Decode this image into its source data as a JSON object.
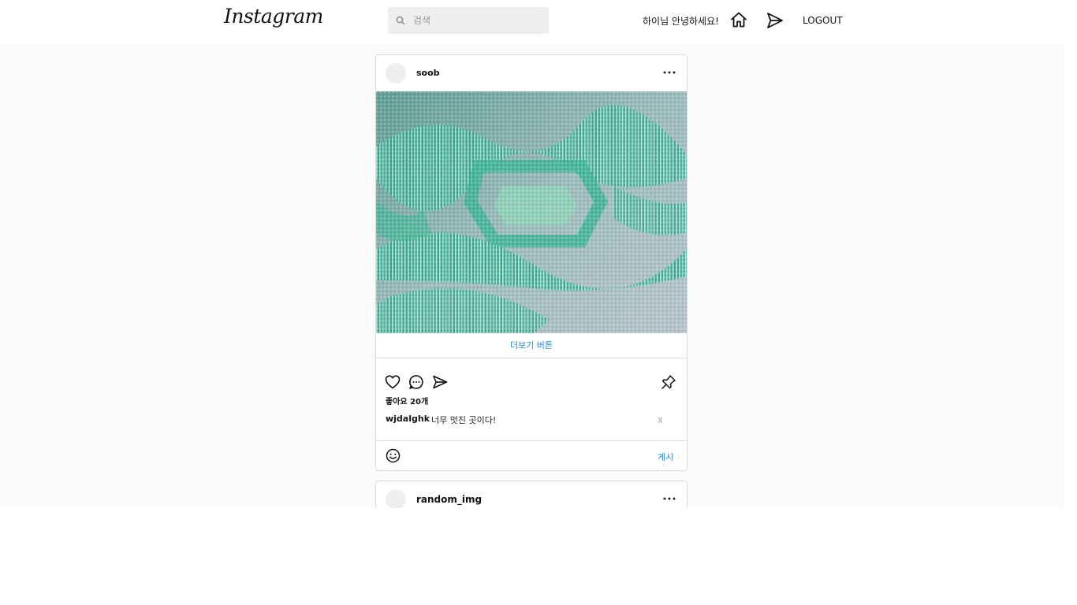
{
  "header": {
    "logo": "Instagram",
    "search_placeholder": "검색",
    "greeting": "하이님 안녕하세요!",
    "logout_label": "LOGOUT",
    "icons": [
      "home-icon",
      "send-icon"
    ]
  },
  "posts": [
    {
      "username": "soob",
      "more_label": "더보기 버튼",
      "likes_label": "좋아요 20개",
      "comment": {
        "user": "wjdalghk",
        "text": "너무 멋진 곳이다!",
        "delete_label": "x"
      },
      "post_label": "게시"
    },
    {
      "username": "random_img"
    }
  ],
  "colors": {
    "accent": "#1f8ae0",
    "background": "#fafafa",
    "border": "#dbdbdb"
  }
}
